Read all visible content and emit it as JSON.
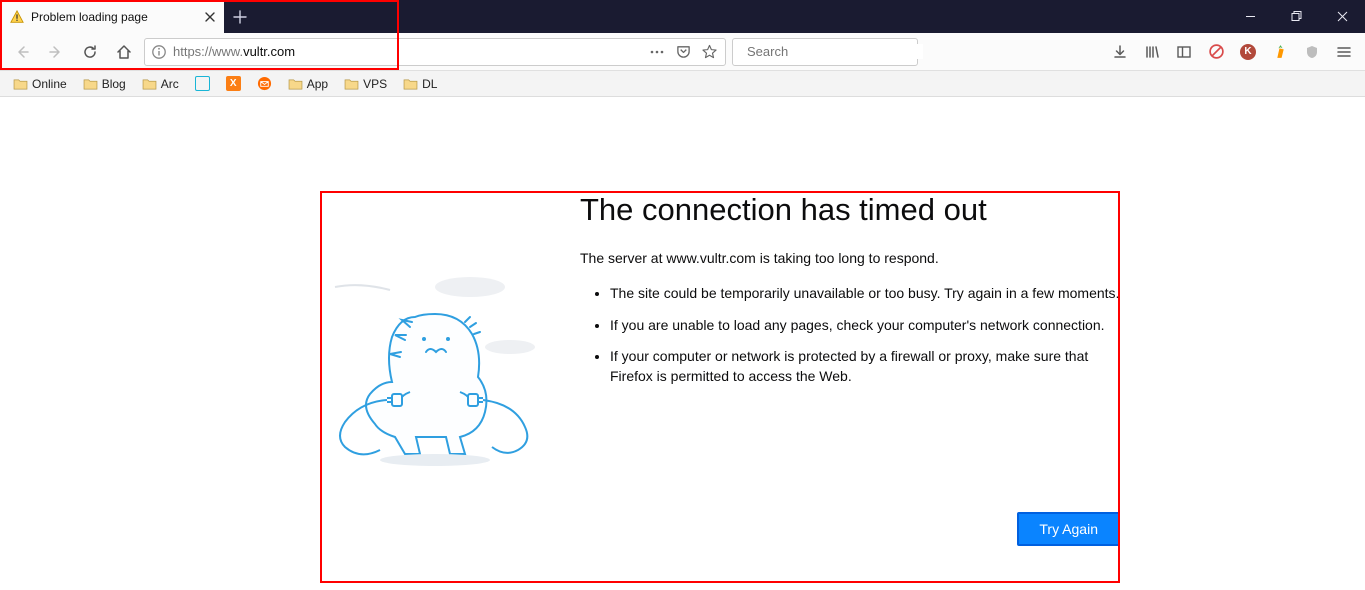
{
  "tab": {
    "title": "Problem loading page"
  },
  "url": {
    "prefix": "https://www.",
    "domain": "vultr.com",
    "suffix": ""
  },
  "search": {
    "placeholder": "Search"
  },
  "bookmarks": [
    {
      "label": "Online",
      "type": "folder"
    },
    {
      "label": "Blog",
      "type": "folder"
    },
    {
      "label": "Arc",
      "type": "folder"
    },
    {
      "label": "",
      "type": "icon-teal"
    },
    {
      "label": "",
      "type": "icon-xampp"
    },
    {
      "label": "",
      "type": "icon-mail"
    },
    {
      "label": "App",
      "type": "folder"
    },
    {
      "label": "VPS",
      "type": "folder"
    },
    {
      "label": "DL",
      "type": "folder"
    }
  ],
  "error": {
    "title": "The connection has timed out",
    "subtitle": "The server at www.vultr.com is taking too long to respond.",
    "bullets": [
      "The site could be temporarily unavailable or too busy. Try again in a few moments.",
      "If you are unable to load any pages, check your computer's network connection.",
      "If your computer or network is protected by a firewall or proxy, make sure that Firefox is permitted to access the Web."
    ],
    "try_again": "Try Again"
  }
}
